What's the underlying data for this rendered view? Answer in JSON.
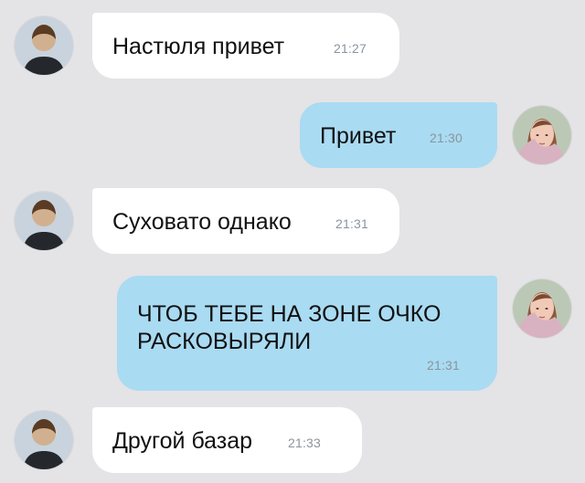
{
  "conversation": {
    "messages": [
      {
        "sender": "contact",
        "text": "Настюля привет",
        "time": "21:27",
        "avatar": "male-avatar-icon"
      },
      {
        "sender": "self",
        "text": "Привет",
        "time": "21:30",
        "avatar": "female-avatar-icon"
      },
      {
        "sender": "contact",
        "text": "Суховато однако",
        "time": "21:31",
        "avatar": "male-avatar-icon"
      },
      {
        "sender": "self",
        "text": "ЧТОБ ТЕБЕ НА ЗОНЕ ОЧКО РАСКОВЫРЯЛИ",
        "time": "21:31",
        "avatar": "female-avatar-icon"
      },
      {
        "sender": "contact",
        "text": "Другой базар",
        "time": "21:33",
        "avatar": "male-avatar-icon"
      }
    ]
  },
  "colors": {
    "background": "#e4e3e6",
    "incoming_bubble": "#ffffff",
    "outgoing_bubble": "#a9dbf2",
    "time_text": "#8b949b"
  }
}
